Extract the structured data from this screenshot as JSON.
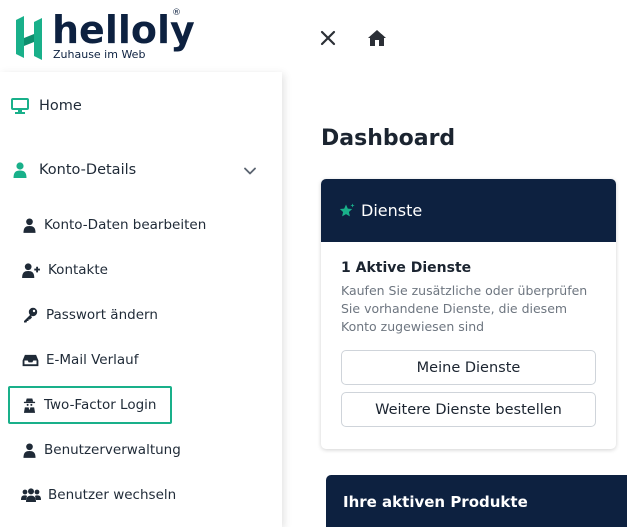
{
  "brand": {
    "name": "helloly",
    "registered_mark": "®",
    "tagline": "Zuhause im Web",
    "colors": {
      "primary": "#0d2140",
      "accent": "#19b08a"
    }
  },
  "toolbar": {
    "close_icon": "close-icon",
    "home_icon": "home-icon"
  },
  "sidebar": {
    "home": {
      "label": "Home",
      "icon": "monitor-icon"
    },
    "account_section": {
      "label": "Konto-Details",
      "icon": "user-icon",
      "expanded": true
    },
    "items": [
      {
        "label": "Konto-Daten bearbeiten",
        "icon": "user-icon"
      },
      {
        "label": "Kontakte",
        "icon": "user-plus-icon"
      },
      {
        "label": "Passwort ändern",
        "icon": "key-icon"
      },
      {
        "label": "E-Mail Verlauf",
        "icon": "inbox-icon"
      },
      {
        "label": "Two-Factor Login",
        "icon": "user-secret-icon",
        "active": true
      },
      {
        "label": "Benutzerverwaltung",
        "icon": "user-icon"
      },
      {
        "label": "Benutzer wechseln",
        "icon": "users-icon"
      }
    ]
  },
  "main": {
    "title": "Dashboard",
    "services_card": {
      "header": "Dienste",
      "header_icon": "star-icon",
      "active_count": "1 Aktive Dienste",
      "description": "Kaufen Sie zusätzliche oder überprüfen Sie vorhandene Dienste, die diesem Konto zugewiesen sind",
      "button_primary": "Meine Dienste",
      "button_secondary": "Weitere Dienste bestellen"
    },
    "products_card": {
      "header": "Ihre aktiven Produkte"
    }
  }
}
